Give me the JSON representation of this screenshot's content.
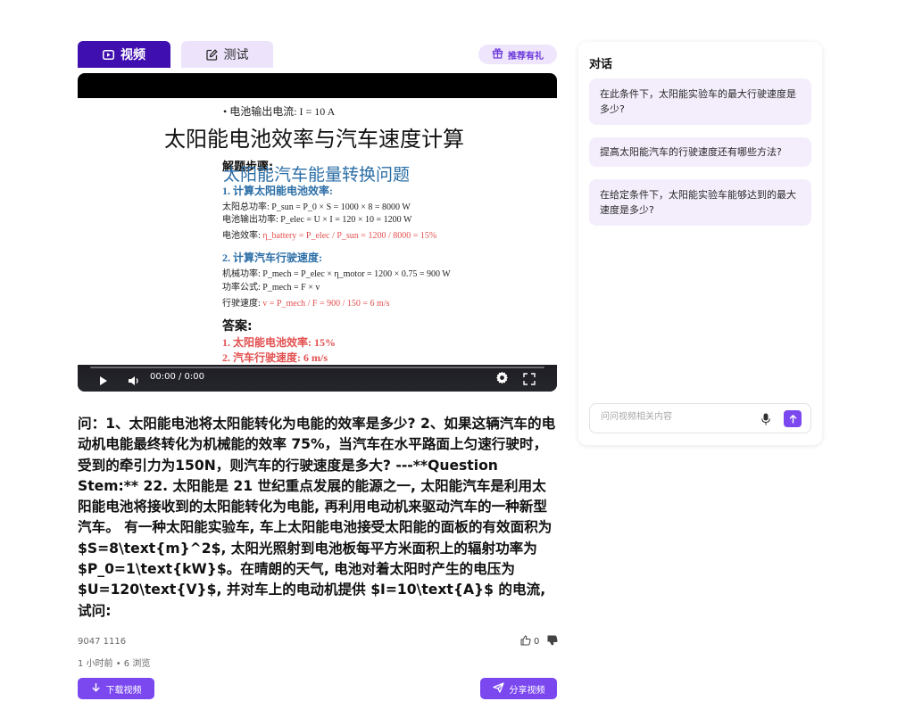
{
  "tabs": {
    "video_label": "视频",
    "test_label": "测试",
    "promo_label": "推荐有礼"
  },
  "slide": {
    "bullet_current": "• 电池输出电流: I = 10 A",
    "title_main": "太阳能电池效率与汽车速度计算",
    "steps_label": "解题步骤:",
    "subtitle": "太阳能汽车能量转换问题",
    "step1_title": "1. 计算太阳能电池效率:",
    "step1_line1": "太阳总功率: P_sun = P_0 × S = 1000 × 8 = 8000 W",
    "step1_line2": "电池输出功率: P_elec = U × I = 120 × 10 = 1200 W",
    "step1_line3_label": "电池效率: ",
    "step1_line3_formula": "η_battery = P_elec / P_sun = 1200 / 8000 = 15%",
    "step2_title": "2. 计算汽车行驶速度:",
    "step2_line1": "机械功率: P_mech = P_elec × η_motor = 1200 × 0.75 = 900 W",
    "step2_line2": "功率公式: P_mech = F × v",
    "step2_line3_label": "行驶速度: ",
    "step2_line3_formula": "v = P_mech / F = 900 / 150 = 6 m/s",
    "answer_label": "答案:",
    "answer1": "1. 太阳能电池效率: 15%",
    "answer2": "2. 汽车行驶速度: 6 m/s"
  },
  "player": {
    "time": "00:00 / 0:00",
    "progress": 0
  },
  "question": {
    "text": "问：1、太阳能电池将太阳能转化为电能的效率是多少? 2、如果这辆汽车的电动机电能最终转化为机械能的效率 75%，当汽车在水平路面上匀速行驶时，受到的牵引力为150N，则汽车的行驶速度是多大? ---**Question Stem:** 22. 太阳能是 21 世纪重点发展的能源之一, 太阳能汽车是利用太阳能电池将接收到的太阳能转化为电能, 再利用电动机来驱动汽车的一种新型汽车。 有一种太阳能实验车, 车上太阳能电池接受太阳能的面板的有效面积为 $S=8\\text{m}^2$, 太阳光照射到电池板每平方米面积上的辐射功率为 $P_0=1\\text{kW}$。在晴朗的天气, 电池对着太阳时产生的电压为 $U=120\\text{V}$, 并对车上的电动机提供 $I=10\\text{A}$ 的电流, 试问:"
  },
  "meta": {
    "id": "9047 1116",
    "time_views": "1 小时前 • 6 浏览",
    "likes": "0"
  },
  "actions": {
    "download_label": "下载视频",
    "share_label": "分享视频"
  },
  "chat": {
    "title": "对话",
    "suggestions": [
      "在此条件下，太阳能实验车的最大行驶速度是多少?",
      "提高太阳能汽车的行驶速度还有哪些方法?",
      "在给定条件下，太阳能实验车能够达到的最大速度是多少?"
    ],
    "input_placeholder": "问问视频相关内容"
  },
  "colors": {
    "accent": "#7b48f0",
    "tab_active": "#3f0fb0",
    "tab_inactive": "#ede4fb",
    "suggestion_bg": "#f4eefc",
    "slide_blue": "#2b6ea6",
    "slide_red": "#e35050"
  }
}
